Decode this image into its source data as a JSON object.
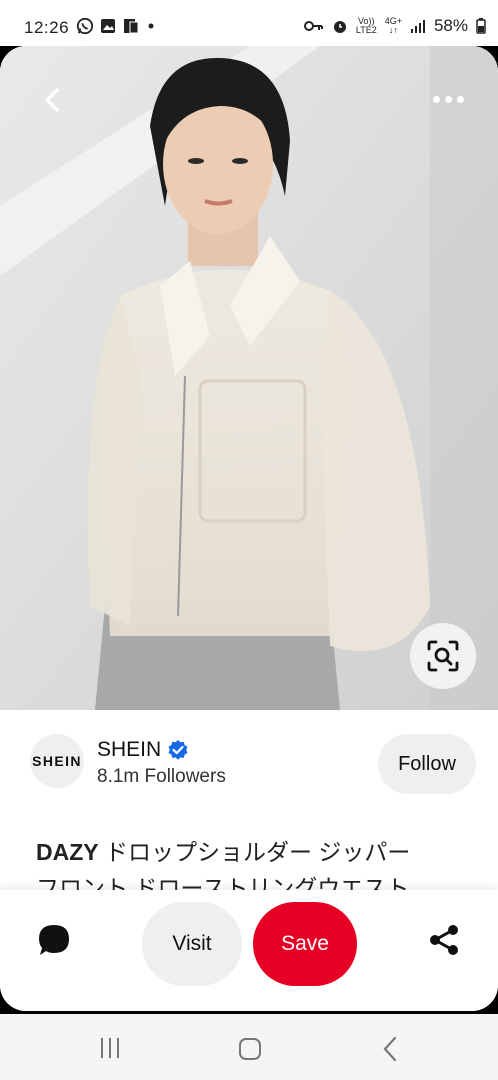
{
  "status_bar": {
    "time": "12:26",
    "network_top": "Vo))",
    "network_bottom": "LTE2",
    "signal_type": "4G+",
    "battery": "58%",
    "icons": [
      "whatsapp-icon",
      "gallery-icon",
      "sim-card-icon",
      "dot-icon",
      "key-icon",
      "alarm-icon",
      "signal-icon",
      "battery-icon"
    ]
  },
  "pin": {
    "nav_icons": [
      "back-arrow-icon",
      "more-dots-icon",
      "visual-search-icon"
    ]
  },
  "profile": {
    "avatar_text": "SHEIN",
    "name": "SHEIN",
    "verified": true,
    "followers": "8.1m Followers",
    "follow_label": "Follow"
  },
  "description": {
    "brand": "DAZY",
    "line1": "ドロップショルダー ジッパー",
    "line2": "フロント ドローストリングウエスト"
  },
  "actions": {
    "visit_label": "Visit",
    "save_label": "Save",
    "save_color": "#e60023",
    "icons": [
      "comment-icon",
      "share-icon"
    ]
  },
  "system_nav": {
    "icons": [
      "recents-icon",
      "home-icon",
      "back-icon"
    ]
  }
}
